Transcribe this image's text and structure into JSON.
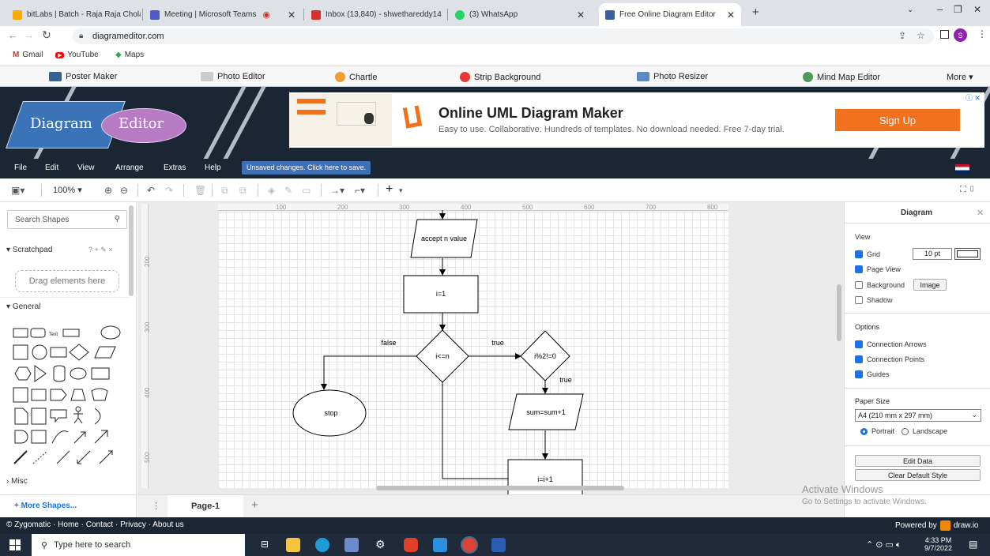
{
  "browser": {
    "tabs": [
      {
        "title": "bitLabs | Batch - Raja Raja Chola",
        "color": "#f9ab00"
      },
      {
        "title": "Meeting | Microsoft Teams",
        "color": "#5059c9"
      },
      {
        "title": "Inbox (13,840) - shwethareddy14",
        "color": "#d93025"
      },
      {
        "title": "(3) WhatsApp",
        "color": "#25d366"
      },
      {
        "title": "Free Online Diagram Editor",
        "color": "#3b5fa0"
      }
    ],
    "url": "diagrameditor.com",
    "bookmarks": [
      "Gmail",
      "YouTube",
      "Maps"
    ]
  },
  "site_nav": [
    "Poster Maker",
    "Photo Editor",
    "Chartle",
    "Strip Background",
    "Photo Resizer",
    "Mind Map Editor",
    "More ▾"
  ],
  "logo": {
    "word1": "Diagram",
    "word2": "Editor"
  },
  "ad": {
    "title": "Online UML Diagram Maker",
    "subtitle": "Easy to use. Collaborative. Hundreds of templates. No download needed. Free 7-day trial.",
    "button": "Sign Up"
  },
  "menu": [
    "File",
    "Edit",
    "View",
    "Arrange",
    "Extras",
    "Help"
  ],
  "unsaved": "Unsaved changes. Click here to save.",
  "toolbar": {
    "zoom": "100%"
  },
  "left_panel": {
    "search_placeholder": "Search Shapes",
    "scratchpad": "Scratchpad",
    "scratchpad_actions": "? + ✎ ×",
    "drag_hint": "Drag elements here",
    "general": "General",
    "shape_text": "Text",
    "misc": "Misc",
    "more_shapes": "+ More Shapes..."
  },
  "ruler_ticks": [
    "100",
    "200",
    "300",
    "400",
    "500",
    "600",
    "700",
    "800"
  ],
  "vruler_ticks": [
    "200",
    "300",
    "400",
    "500"
  ],
  "flowchart": {
    "accept": "accept n value",
    "init": "i=1",
    "cond": "i<=n",
    "false_label": "false",
    "true_label": "true",
    "check": "i%2!=0",
    "true2": "true",
    "stop": "stop",
    "sum": "sum=sum+1",
    "inc": "i=i+1"
  },
  "right_panel": {
    "title": "Diagram",
    "view": "View",
    "grid": "Grid",
    "grid_size": "10 pt",
    "page_view": "Page View",
    "background": "Background",
    "image_btn": "Image",
    "shadow": "Shadow",
    "options": "Options",
    "conn_arrows": "Connection Arrows",
    "conn_points": "Connection Points",
    "guides": "Guides",
    "paper_size": "Paper Size",
    "paper_value": "A4 (210 mm x 297 mm)",
    "portrait": "Portrait",
    "landscape": "Landscape",
    "edit_data": "Edit Data",
    "clear_style": "Clear Default Style"
  },
  "page_tab": "Page-1",
  "watermark": {
    "line1": "Activate Windows",
    "line2": "Go to Settings to activate Windows."
  },
  "footer": {
    "left": "© Zygomatic · Home · Contact · Privacy · About us",
    "right": "Powered by",
    "brand": "draw.io"
  },
  "taskbar": {
    "search": "Type here to search",
    "time": "4:33 PM",
    "date": "9/7/2022"
  }
}
